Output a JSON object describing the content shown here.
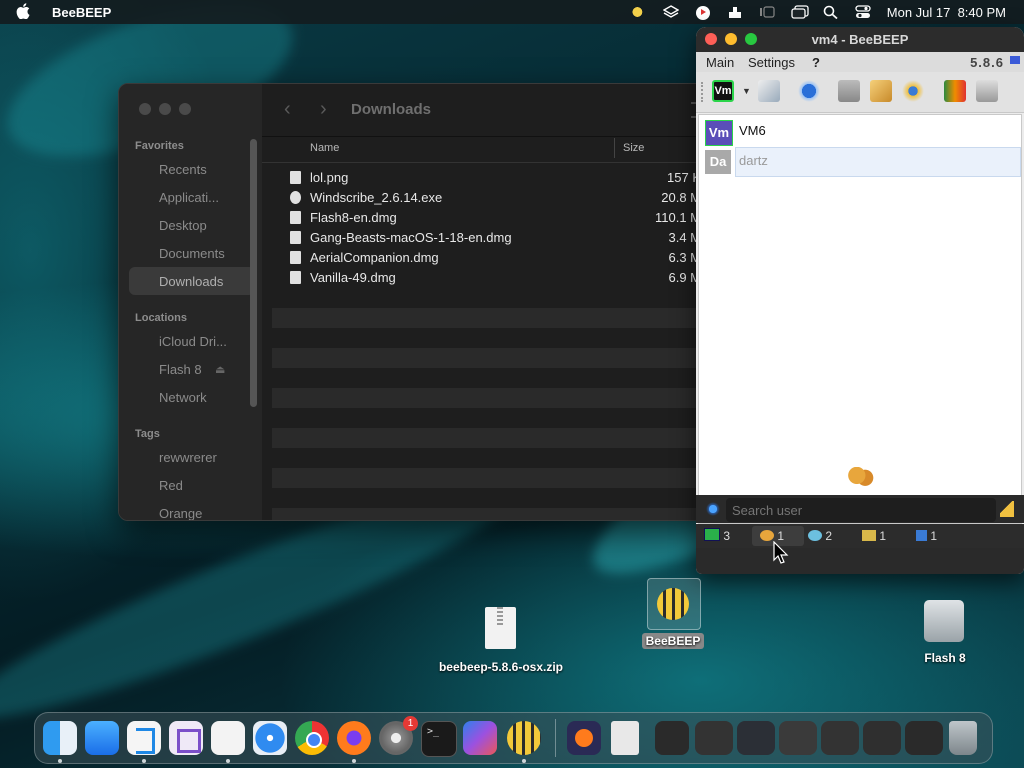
{
  "menubar": {
    "app_name": "BeeBEEP",
    "datetime": "Mon Jul 17  8:40 PM"
  },
  "finder": {
    "title": "Downloads",
    "sidebar": {
      "favorites_label": "Favorites",
      "favorites": [
        "Recents",
        "Applicati...",
        "Desktop",
        "Documents",
        "Downloads"
      ],
      "locations_label": "Locations",
      "locations": [
        "iCloud Dri...",
        "Flash 8",
        "Network"
      ],
      "tags_label": "Tags",
      "tags": [
        "rewwrerer",
        "Red",
        "Orange"
      ]
    },
    "columns": {
      "name": "Name",
      "size": "Size"
    },
    "files": [
      {
        "name": "lol.png",
        "size": "157 K"
      },
      {
        "name": "Windscribe_2.6.14.exe",
        "size": "20.8 M"
      },
      {
        "name": "Flash8-en.dmg",
        "size": "110.1 M"
      },
      {
        "name": "Gang-Beasts-macOS-1-18-en.dmg",
        "size": "3.4 M"
      },
      {
        "name": "AerialCompanion.dmg",
        "size": "6.3 M"
      },
      {
        "name": "Vanilla-49.dmg",
        "size": "6.9 M"
      }
    ]
  },
  "beebeep": {
    "title": "vm4 - BeeBEEP",
    "version": "5.8.6",
    "menu": {
      "main": "Main",
      "settings": "Settings",
      "help": "?"
    },
    "toolbar_avatar": "Vm",
    "users": [
      {
        "initials": "Vm",
        "name": "VM6",
        "color": "#5a4fb8",
        "online": true
      },
      {
        "initials": "Da",
        "name": "dartz",
        "color": "#a9a9a9",
        "online": false
      }
    ],
    "search_placeholder": "Search user",
    "tabs": [
      "3",
      "1",
      "2",
      "1",
      "1"
    ]
  },
  "desktop": {
    "zip_label": "beebeep-5.8.6-osx.zip",
    "bee_label": "BeeBEEP",
    "drive_label": "Flash 8"
  },
  "dock": {
    "settings_badge": "1"
  }
}
